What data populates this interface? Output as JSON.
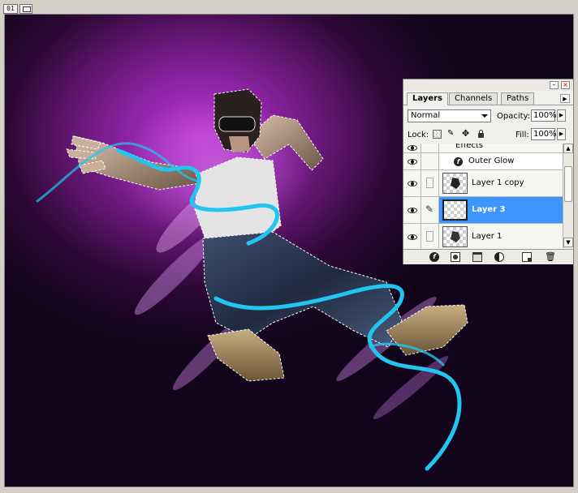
{
  "document": {
    "badge_number": "01",
    "badge_icon": "window-icon"
  },
  "layers_panel": {
    "tabs": [
      {
        "label": "Layers",
        "active": true
      },
      {
        "label": "Channels",
        "active": false
      },
      {
        "label": "Paths",
        "active": false
      }
    ],
    "blend_mode": "Normal",
    "opacity_label": "Opacity:",
    "opacity_value": "100%",
    "lock_label": "Lock:",
    "fill_label": "Fill:",
    "fill_value": "100%",
    "effects_label": "Effects",
    "outer_glow_label": "Outer Glow",
    "layers": [
      {
        "name": "Layer 1 copy",
        "selected": false,
        "visible": true
      },
      {
        "name": "Layer 3",
        "selected": true,
        "visible": true
      },
      {
        "name": "Layer 1",
        "selected": false,
        "visible": true
      }
    ],
    "selection_color": "#3d95ff"
  },
  "canvas": {
    "background_colors": [
      "#b835cf",
      "#12041a"
    ],
    "stripe_color": "#22c4f0"
  }
}
